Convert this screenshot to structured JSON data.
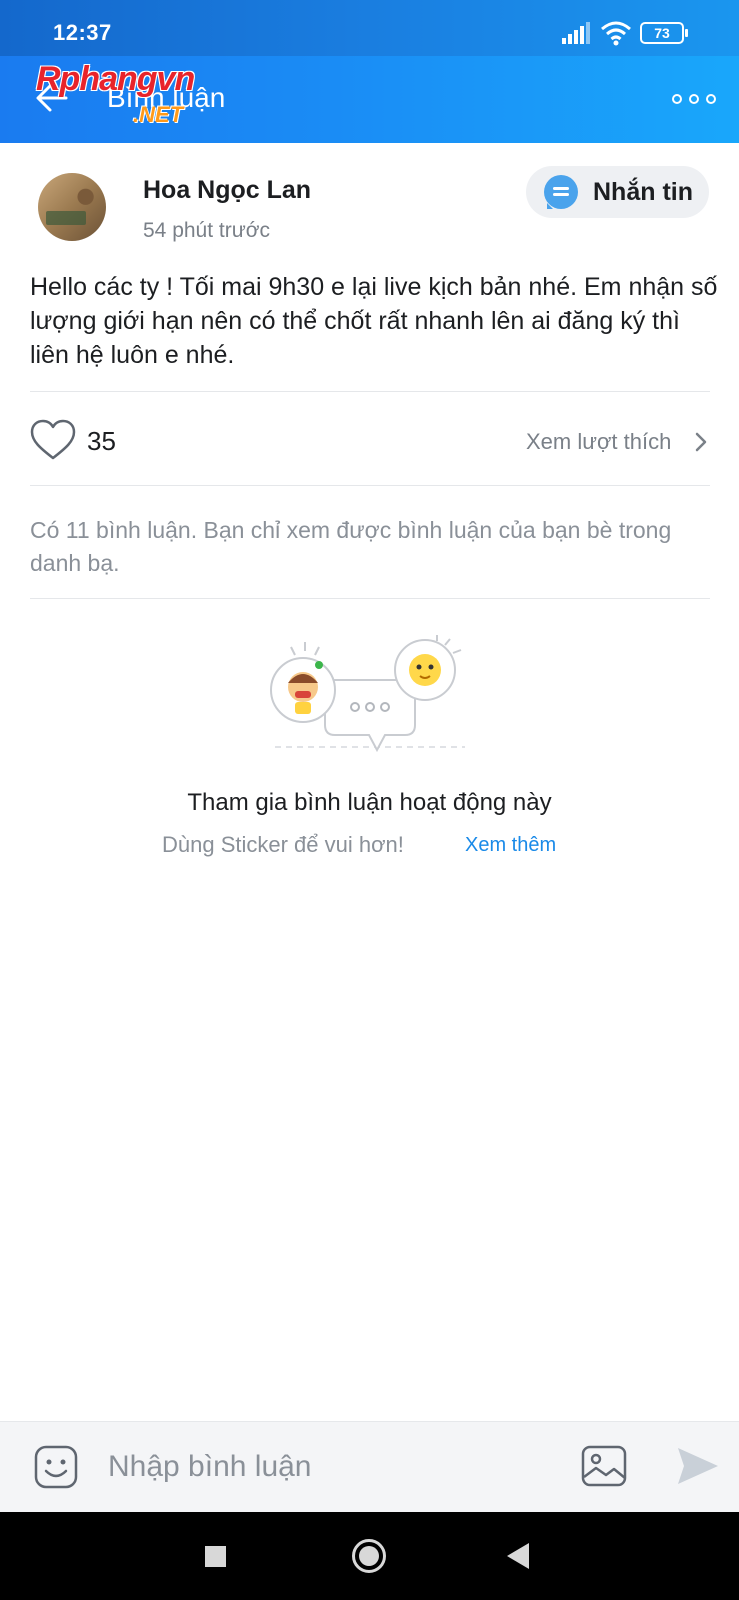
{
  "status_bar": {
    "time": "12:37",
    "battery": "73"
  },
  "header": {
    "title": "Bình luận",
    "watermark": "Rphangvn",
    "watermark_net": ".NET"
  },
  "post": {
    "author": "Hoa Ngọc Lan",
    "time": "54 phút trước",
    "message_button": "Nhắn tin",
    "body": "Hello các ty ! Tối mai 9h30 e lại live kịch bản nhé. Em nhận số lượng giới hạn nên có thể chốt rất nhanh lên ai đăng ký thì liên hệ luôn e nhé.",
    "like_count": "35",
    "view_likes": "Xem lượt thích",
    "comment_note": "Có 11 bình luận. Bạn chỉ xem được bình luận của bạn bè trong danh bạ."
  },
  "empty_state": {
    "title": "Tham gia bình luận hoạt động này",
    "subtitle": "Dùng Sticker để vui hơn!",
    "link": "Xem thêm"
  },
  "composer": {
    "placeholder": "Nhập bình luận"
  },
  "colors": {
    "header_start": "#1a7bf0",
    "header_end": "#19a7fb",
    "link": "#1a8ae8",
    "muted": "#8a9098"
  }
}
